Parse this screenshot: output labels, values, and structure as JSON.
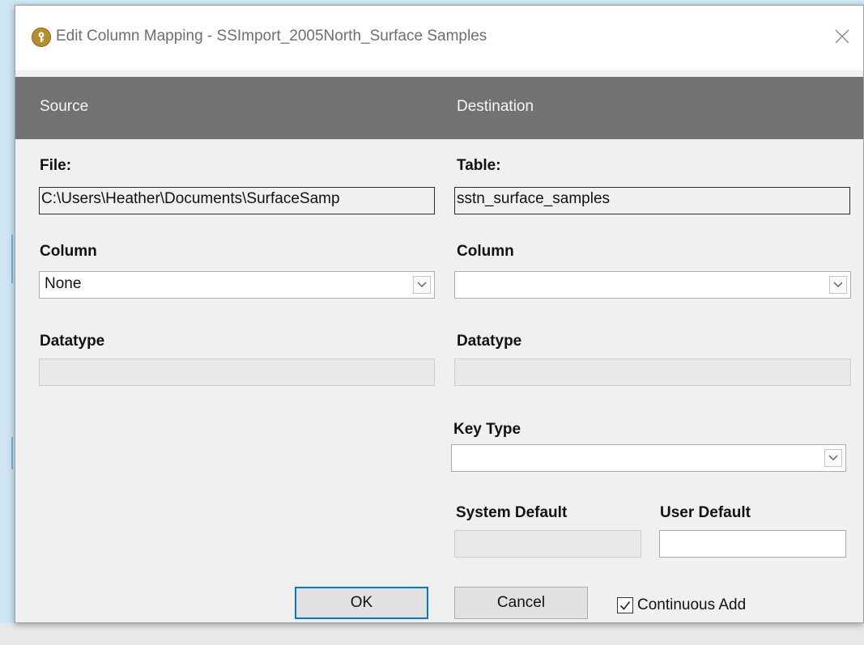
{
  "window": {
    "title": "Edit Column Mapping - SSImport_2005North_Surface Samples",
    "icon": "key-icon",
    "close_icon": "close-icon"
  },
  "header": {
    "source_label": "Source",
    "destination_label": "Destination"
  },
  "source": {
    "file_label": "File:",
    "file_value": "C:\\Users\\Heather\\Documents\\SurfaceSamp",
    "column_label": "Column",
    "column_value": "None",
    "datatype_label": "Datatype",
    "datatype_value": ""
  },
  "destination": {
    "table_label": "Table:",
    "table_value": "sstn_surface_samples",
    "column_label": "Column",
    "column_value": "",
    "datatype_label": "Datatype",
    "datatype_value": "",
    "key_type_label": "Key Type",
    "key_type_value": "",
    "system_default_label": "System Default",
    "system_default_value": "",
    "user_default_label": "User Default",
    "user_default_value": ""
  },
  "buttons": {
    "ok": "OK",
    "cancel": "Cancel"
  },
  "continuous_add": {
    "label": "Continuous Add",
    "checked": true
  },
  "colors": {
    "header_band": "#727272",
    "default_button_border": "#0078d7",
    "window_bg": "#f0f0f0"
  }
}
